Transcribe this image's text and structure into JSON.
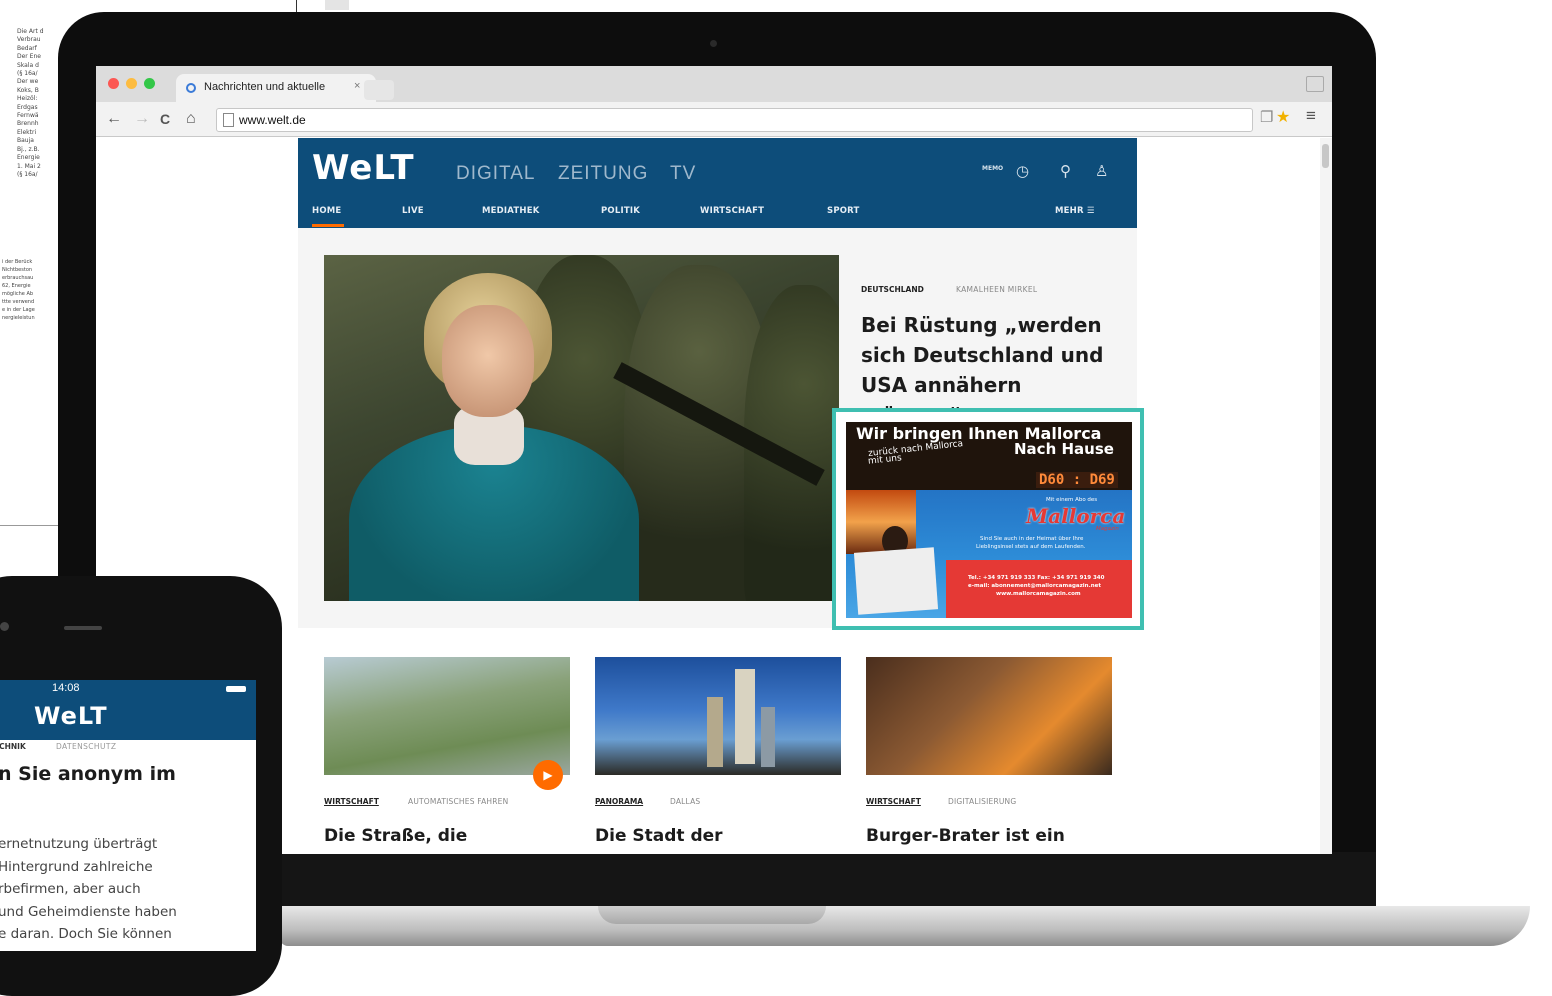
{
  "background_doc": {
    "col1": [
      "Die Art d",
      "Verbrau",
      "Bedarf",
      "Der Ene",
      "Skala d",
      "(§ 16a/",
      "Der we",
      "Koks, B",
      "Heizöl:",
      "Erdgas",
      "Fernwä",
      "Brennh",
      "Elektri",
      "Bauja",
      "Bj., z.B.",
      "Energie",
      "1. Mai 2",
      "(§ 16a/"
    ],
    "col2": [
      "i der Berück",
      "Nichtbeston",
      "erbrauchsau",
      "62, Energie",
      "mögliche Ab",
      "ttte verwend",
      "e in der Lage",
      "nergieleistun"
    ]
  },
  "browser": {
    "tab_title": "Nachrichten und aktuelle",
    "tab_close": "×",
    "url": "www.welt.de",
    "back": "←",
    "forward": "→",
    "reload": "C",
    "home": "⌂"
  },
  "welt": {
    "logo": "WeLT",
    "top_nav": [
      "DIGITAL",
      "ZEITUNG",
      "TV"
    ],
    "section_nav": [
      "HOME",
      "LIVE",
      "MEDIATHEK",
      "POLITIK",
      "WIRTSCHAFT",
      "SPORT"
    ],
    "more": "MEHR ☰",
    "memo": "MEMO",
    "search_icon": "⚲",
    "user_icon": "♙"
  },
  "lead": {
    "kicker": "DEUTSCHLAND",
    "kicker_sub": "KAMALHEEN MIRKEL",
    "headline": "Bei Rüstung „werden sich Deutschland und USA annähern müssen“"
  },
  "ad": {
    "title": "Wir bringen Ihnen Mallorca",
    "title2": "Nach Hause",
    "handwriting_1": "zurück nach Mallorca",
    "handwriting_2": "mit uns",
    "board": "D60 : D69",
    "slogan": "Mit einem Abo des",
    "brand": "Mallorca",
    "brand_sub": "Magazin",
    "tagline_1": "Sind Sie auch in der Heimat über Ihre",
    "tagline_2": "Lieblingsinsel stets auf dem Laufenden.",
    "contact_1": "Tel.: +34 971 919 333  Fax: +34 971 919 340",
    "contact_2": "e-mail: abonnement@mallorcamagazin.net",
    "contact_3": "www.mallorcamagazin.com"
  },
  "teasers": [
    {
      "kicker": "WIRTSCHAFT",
      "sub": "AUTOMATISCHES FAHREN",
      "headline": "Die Straße, die"
    },
    {
      "kicker": "PANORAMA",
      "sub": "DALLAS",
      "headline": "Die Stadt der"
    },
    {
      "kicker": "WIRTSCHAFT",
      "sub": "DIGITALISIERUNG",
      "headline": "Burger-Brater ist ein"
    }
  ],
  "phone": {
    "time": "14:08",
    "logo": "WeLT",
    "kicker": "ECHNIK",
    "kicker_sub": "DATENSCHUTZ",
    "headline": "n Sie anonym im",
    "body": [
      "ernetnutzung überträgt",
      "Hintergrund zahlreiche",
      "rbefirmen, aber auch",
      "und Geheimdienste haben",
      "e daran. Doch Sie können"
    ]
  }
}
